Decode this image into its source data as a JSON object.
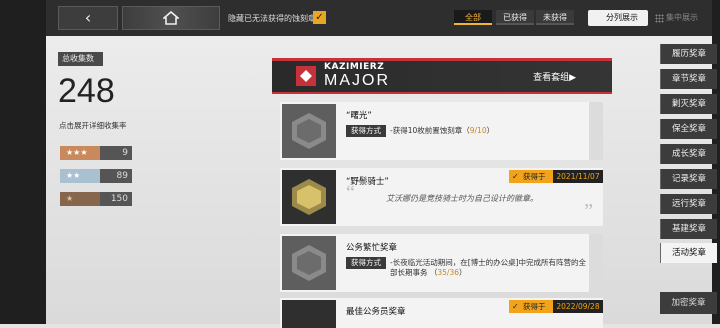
{
  "topbar": {
    "back_icon": "back-arrow-icon",
    "home_icon": "home-icon",
    "hide_label": "隐藏已无法获得的蚀刻章",
    "hide_checked": true,
    "filters": {
      "all": "全部",
      "obtained": "已获得",
      "not_obtained": "未获得"
    },
    "view_split": "分列展示",
    "view_gather": "集中展示"
  },
  "stats": {
    "total_label": "总收集数",
    "total": "248",
    "detail_label": "点击展开详细收集率",
    "rarity": [
      {
        "stars": "★★★",
        "count": "9"
      },
      {
        "stars": "★★",
        "count": "89"
      },
      {
        "stars": "★",
        "count": "150"
      }
    ]
  },
  "sidebar": {
    "items": [
      "履历奖章",
      "章节奖章",
      "剿灭奖章",
      "保全奖章",
      "成长奖章",
      "记录奖章",
      "远行奖章",
      "基建奖章",
      "活动奖章"
    ],
    "active": "活动奖章",
    "secret": "加密奖章"
  },
  "banner": {
    "title_small": "KAZIMIERZ",
    "title_big": "MAJOR",
    "view_set": "查看套组▶"
  },
  "cards": [
    {
      "name": "“曙光”",
      "method_tag": "获得方式",
      "method": "-获得10枚前置蚀刻章（",
      "progress": "9/10",
      "method_end": "）"
    },
    {
      "name": "“野鬃骑士”",
      "got_label": "获得于",
      "got_date": "2021/11/07",
      "desc": "艾沃娜仍是竞技骑士时为自己设计的徽章。"
    },
    {
      "name": "公务繁忙奖章",
      "method_tag": "获得方式",
      "method": "-长夜临光活动期间，在[博士的办公桌]中完成所有阵营的全部长期事务 （",
      "progress": "35/36",
      "method_end": "）"
    },
    {
      "name": "最佳公务员奖章",
      "got_label": "获得于",
      "got_date": "2022/09/28"
    }
  ],
  "colors": {
    "accent": "#f3b43a",
    "banner_red": "#c5323a"
  }
}
